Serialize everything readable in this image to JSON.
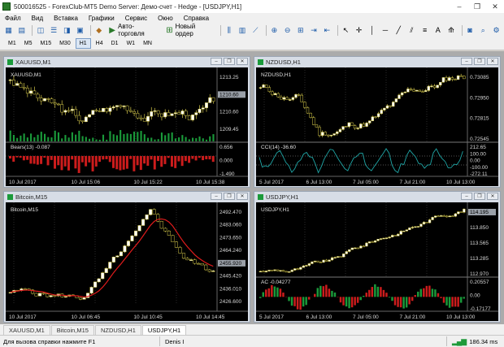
{
  "window": {
    "title": "500016525 - ForexClub-MT5 Demo Server: Демо-счет - Hedge - [USDJPY,H1]",
    "min": "–",
    "max": "❐",
    "close": "✕"
  },
  "menu": [
    "Файл",
    "Вид",
    "Вставка",
    "Графики",
    "Сервис",
    "Окно",
    "Справка"
  ],
  "toolbar": {
    "autotrade": "Авто-торговля",
    "neworder": "Новый ордер"
  },
  "timeframes": [
    {
      "label": "M1"
    },
    {
      "label": "M5"
    },
    {
      "label": "M15"
    },
    {
      "label": "M30"
    },
    {
      "label": "H1",
      "selected": true
    },
    {
      "label": "H4"
    },
    {
      "label": "D1"
    },
    {
      "label": "W1"
    },
    {
      "label": "MN"
    }
  ],
  "colors": {
    "up": "#ffffff",
    "down": "#d4c84a",
    "wick": "#d4c84a",
    "grid": "#2a2a2a",
    "volume": "#1a9a3a",
    "bears": "#cc1c1c",
    "cci": "#1fa6a6",
    "ma": "#e01c1c",
    "ac_up": "#1a9a3a",
    "ac_down": "#cc1c1c"
  },
  "charts": [
    {
      "symbol": "XAUUSD,M1",
      "label": "XAUUSD,M1",
      "price_ticks": [
        "1213.25",
        "1210.60",
        "1210.60",
        "1209.45"
      ],
      "current_price": "1210.60",
      "indicator_label": "Bears(13) -0.087",
      "indicator_ticks": [
        "0.656",
        "0.000",
        "-1.490"
      ],
      "time_labels": [
        "10 Jul 2017",
        "10 Jul 15:06",
        "10 Jul 15:22",
        "10 Jul 15:38"
      ]
    },
    {
      "symbol": "NZDUSD,H1",
      "label": "NZDUSD,H1",
      "price_ticks": [
        "0.73085",
        "0.72950",
        "0.72815",
        "0.72545"
      ],
      "current_price": "0.72735",
      "indicator_label": "CCI(14) -36.60",
      "indicator_ticks": [
        "212.65",
        "100.00",
        "0.00",
        "-100.00",
        "-272.11"
      ],
      "time_labels": [
        "5 Jul 2017",
        "6 Jul 13:00",
        "7 Jul 05:00",
        "7 Jul 21:00",
        "10 Jul 13:00"
      ]
    },
    {
      "symbol": "Bitcoin,M15",
      "label": "Bitcoin,M15",
      "price_ticks": [
        "2492.470",
        "2483.060",
        "2473.650",
        "2464.240",
        "2455.920",
        "2445.420",
        "2436.010",
        "2426.600"
      ],
      "current_price": "2455.920",
      "indicator_label": "",
      "indicator_ticks": [],
      "time_labels": [
        "10 Jul 2017",
        "10 Jul 06:45",
        "10 Jul 10:45",
        "10 Jul 14:45"
      ]
    },
    {
      "symbol": "USDJPY,H1",
      "label": "USDJPY,H1",
      "price_ticks": [
        "114.195",
        "113.850",
        "113.565",
        "113.285",
        "112.970"
      ],
      "current_price": "114.195",
      "indicator_label": "AC -0.04277",
      "indicator_ticks": [
        "0.20557",
        "0.00",
        "-0.17177"
      ],
      "time_labels": [
        "5 Jul 2017",
        "6 Jul 13:00",
        "7 Jul 05:00",
        "7 Jul 21:00",
        "10 Jul 13:00"
      ]
    }
  ],
  "tabs": [
    {
      "label": "XAUUSD,M1"
    },
    {
      "label": "Bitcoin,M15"
    },
    {
      "label": "NZDUSD,H1"
    },
    {
      "label": "USDJPY,H1",
      "active": true
    }
  ],
  "status": {
    "help": "Для вызова справки нажмите F1",
    "user": "Denis I",
    "ping": "186.34 ms"
  }
}
